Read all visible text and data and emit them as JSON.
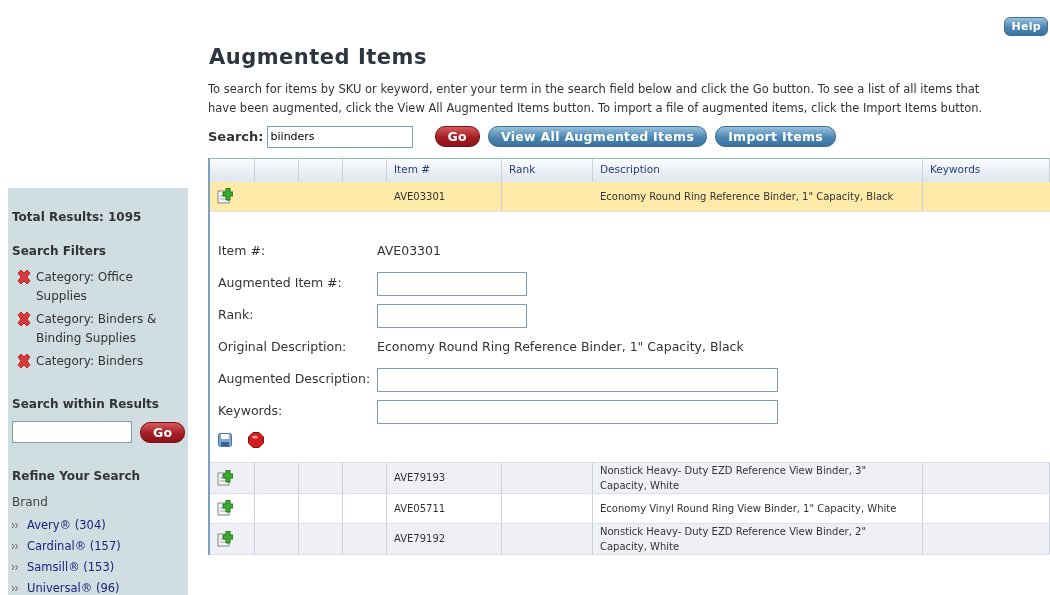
{
  "help_button": "Help",
  "title": "Augmented Items",
  "intro": "To search for items by SKU or keyword, enter your term in the search field below and click the Go button. To see a list of all items that have been augmented, click the View All Augmented Items button. To import a file of augmented items, click the Import Items button.",
  "search": {
    "label": "Search:",
    "value": "biinders",
    "go": "Go",
    "buttons": [
      "View All Augmented Items",
      "Import Items"
    ]
  },
  "sidebar": {
    "total": "Total Results: 1095",
    "filters_title": "Search Filters",
    "filters": [
      "Category: Office Supplies",
      "Category: Binders & Binding Supplies",
      "Category: Binders"
    ],
    "within_title": "Search within Results",
    "within_go": "Go",
    "refine_title": "Refine Your Search",
    "brand_label": "Brand",
    "brands": [
      "Avery® (304)",
      "Cardinal® (157)",
      "Samsill® (153)",
      "Universal® (96)"
    ]
  },
  "table": {
    "columns": [
      "Item #",
      "Rank",
      "Description",
      "Keywords"
    ],
    "rows": [
      {
        "item": "AVE03301",
        "description": "Economy Round Ring Reference Binder, 1\" Capacity, Black",
        "selected": true,
        "expanded": true
      },
      {
        "item": "AVE79193",
        "description": "Nonstick Heavy- Duty EZD Reference View Binder, 3\" Capacity, White",
        "selected": false,
        "expanded": false
      },
      {
        "item": "AVE05711",
        "description": "Economy Vinyl Round Ring View Binder, 1\" Capacity, White",
        "selected": false,
        "expanded": false
      },
      {
        "item": "AVE79192",
        "description": "Nonstick Heavy- Duty EZD Reference View Binder, 2\" Capacity, White",
        "selected": false,
        "expanded": false
      }
    ]
  },
  "detail": {
    "fields": [
      {
        "label": "Item #:",
        "kind": "value",
        "value": "AVE03301"
      },
      {
        "label": "Augmented Item #:",
        "kind": "input"
      },
      {
        "label": "Rank:",
        "kind": "input"
      },
      {
        "label": "Original Description:",
        "kind": "value",
        "value": "Economy Round Ring Reference Binder, 1\" Capacity, Black"
      },
      {
        "label": "Augmented Description:",
        "kind": "wide-input"
      },
      {
        "label": "Keywords:",
        "kind": "wide-input"
      }
    ]
  }
}
